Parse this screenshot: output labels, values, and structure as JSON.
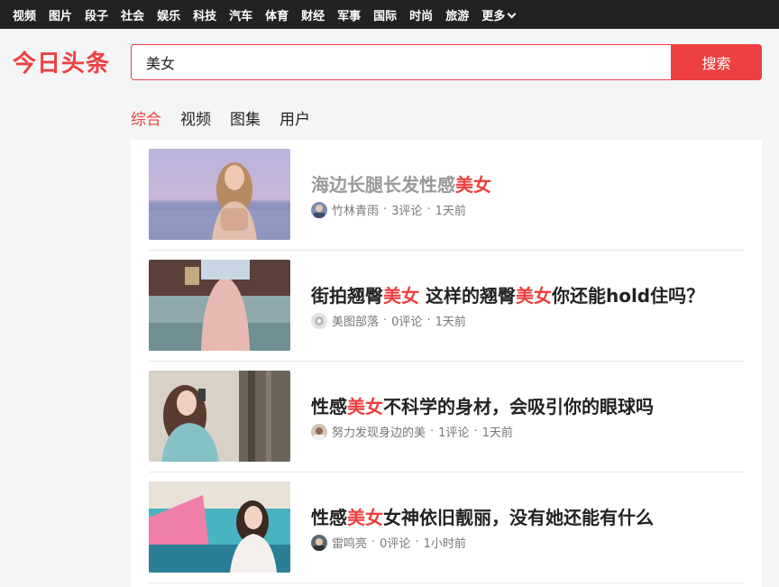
{
  "nav": {
    "items": [
      "视频",
      "图片",
      "段子",
      "社会",
      "娱乐",
      "科技",
      "汽车",
      "体育",
      "财经",
      "军事",
      "国际",
      "时尚",
      "旅游"
    ],
    "more_label": "更多"
  },
  "logo": "今日头条",
  "search": {
    "value": "美女",
    "button_label": "搜索"
  },
  "tabs": [
    "综合",
    "视频",
    "图集",
    "用户"
  ],
  "results": [
    {
      "title_parts": [
        "海边长腿长发性感",
        "美女",
        ""
      ],
      "author": "竹林青雨",
      "comments": "3评论",
      "time": "1天前",
      "visited": true
    },
    {
      "title_parts": [
        "街拍翘臀",
        "美女",
        " 这样的翘臀",
        "美女",
        "你还能hold住吗？"
      ],
      "author": "美图部落",
      "comments": "0评论",
      "time": "1天前",
      "visited": false
    },
    {
      "title_parts": [
        "性感",
        "美女",
        "不科学的身材，会吸引你的眼球吗"
      ],
      "author": "努力发现身边的美",
      "comments": "1评论",
      "time": "1天前",
      "visited": false
    },
    {
      "title_parts": [
        "性感",
        "美女",
        "女神依旧靓丽，没有她还能有什么"
      ],
      "author": "雷鸣亮",
      "comments": "0评论",
      "time": "1小时前",
      "visited": false
    }
  ],
  "colors": {
    "accent": "#ed4040",
    "topbar": "#222222"
  }
}
